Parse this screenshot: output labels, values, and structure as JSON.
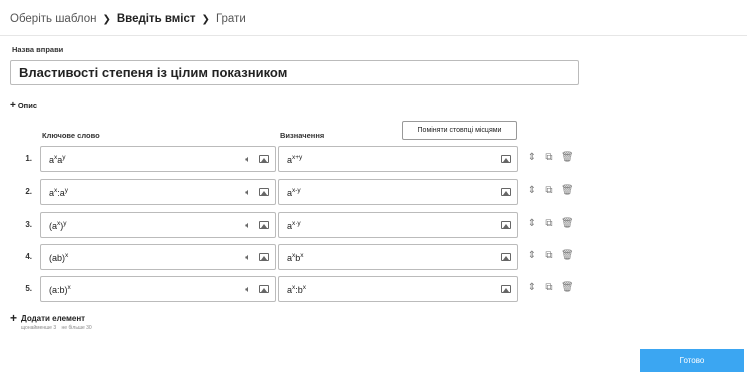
{
  "breadcrumb": {
    "steps": [
      "Оберіть шаблон",
      "Введіть вміст",
      "Грати"
    ],
    "active_index": 1
  },
  "activity": {
    "name_label": "Назва вправи",
    "name_value": "Властивості степеня із цілим показником",
    "description_toggle": "Опис"
  },
  "table": {
    "keyword_header": "Ключове слово",
    "definition_header": "Визначення",
    "swap_columns_label": "Поміняти стовпці місцями",
    "rows": [
      {
        "num": "1.",
        "key_base": "a",
        "key_parts": [
          [
            "a",
            "x"
          ],
          [
            "a",
            "y"
          ]
        ],
        "key_text": "axay",
        "def_text": "ax+y"
      },
      {
        "num": "2.",
        "key_text": "ax:ay",
        "def_text": "ax-y"
      },
      {
        "num": "3.",
        "key_text": "(ax)y",
        "def_text": "ax·y"
      },
      {
        "num": "4.",
        "key_text": "(ab)x",
        "def_text": "axbx"
      },
      {
        "num": "5.",
        "key_text": "(a:b)x",
        "def_text": "ax:bx"
      }
    ]
  },
  "add_item": {
    "label": "Додати елемент",
    "min_hint": "щонайменше 3",
    "max_hint": "не більше 30"
  },
  "done_label": "Готово",
  "icons": {
    "separator": "chevron-right-icon",
    "audio": "speaker-icon",
    "image": "image-icon",
    "move": "up-down-arrows-icon",
    "duplicate": "duplicate-icon",
    "delete": "trash-icon"
  },
  "colors": {
    "accent": "#3ba6f2",
    "border": "#bbbbbb"
  }
}
